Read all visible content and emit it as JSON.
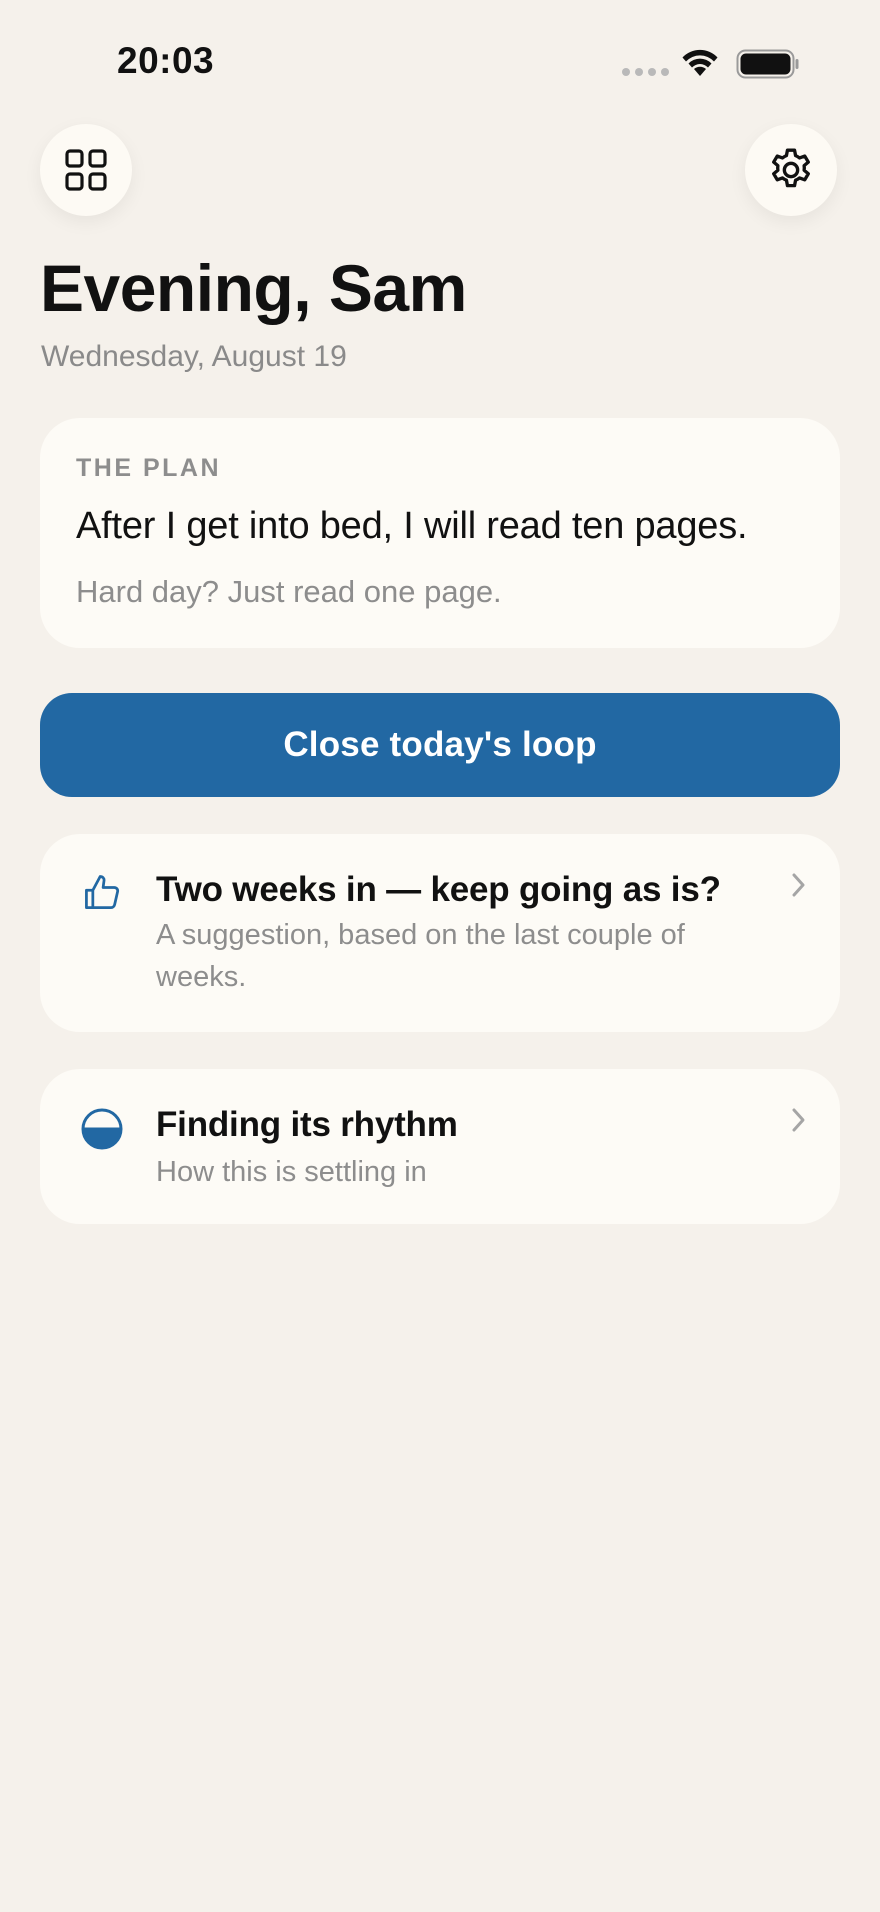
{
  "status_bar": {
    "time": "20:03"
  },
  "header": {
    "greeting": "Evening, Sam",
    "date": "Wednesday, August 19",
    "left_icon": "grid-icon",
    "right_icon": "gear-icon"
  },
  "plan": {
    "label": "THE PLAN",
    "main": "After I get into bed, I will read ten pages.",
    "fallback": "Hard day? Just read one page."
  },
  "primary_action": {
    "label": "Close today's loop"
  },
  "cards": [
    {
      "icon": "thumbs-up-icon",
      "title": "Two weeks in — keep going as is?",
      "subtitle": "A suggestion, based on the last couple of weeks."
    },
    {
      "icon": "half-circle-icon",
      "title": "Finding its rhythm",
      "subtitle": "How this is settling in"
    }
  ],
  "colors": {
    "background": "#f5f1eb",
    "card": "#fdfbf6",
    "accent": "#2268a3",
    "secondary_text": "#8d8d8d"
  }
}
